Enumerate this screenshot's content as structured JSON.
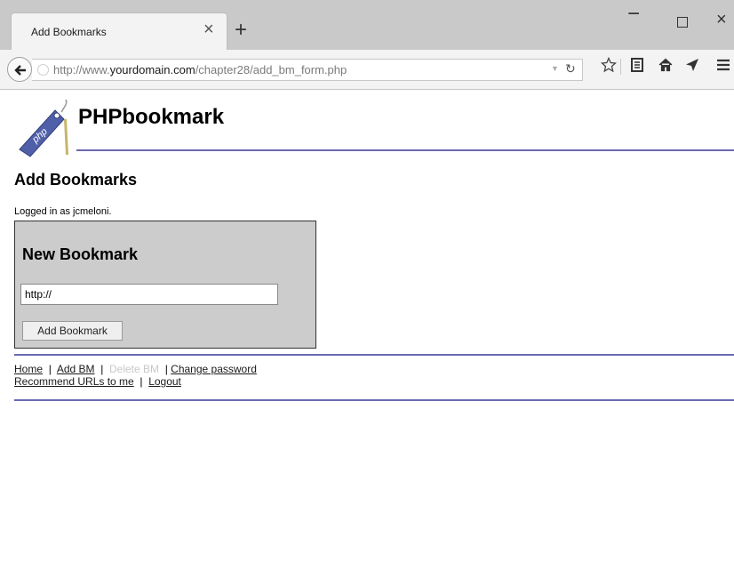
{
  "browser": {
    "tab_title": "Add Bookmarks",
    "tab_close": "×",
    "new_tab": "+",
    "url_prefix": "http://www.",
    "url_domain": "yourdomain.com",
    "url_path": "/chapter28/add_bm_form.php",
    "window_minimize": "−",
    "window_close": "×"
  },
  "site": {
    "title": "PHPbookmark",
    "logo_text": "php",
    "page_heading": "Add Bookmarks",
    "logged_in_text": "Logged in as jcmeloni."
  },
  "form": {
    "title": "New Bookmark",
    "url_value": "http://",
    "submit_label": "Add Bookmark"
  },
  "nav_links": {
    "home": "Home",
    "add_bm": "Add BM",
    "delete_bm": "Delete BM",
    "change_password": "Change password",
    "recommend": "Recommend URLs to me",
    "logout": "Logout",
    "separator": "|"
  },
  "colors": {
    "rule": "#6a6ab0",
    "form_bg": "#cccccc",
    "disabled_link": "#c8c8c8"
  },
  "icons": [
    "back-arrow-icon",
    "globe-icon",
    "reload-icon",
    "star-icon",
    "reader-icon",
    "home-icon",
    "send-icon",
    "menu-icon"
  ]
}
